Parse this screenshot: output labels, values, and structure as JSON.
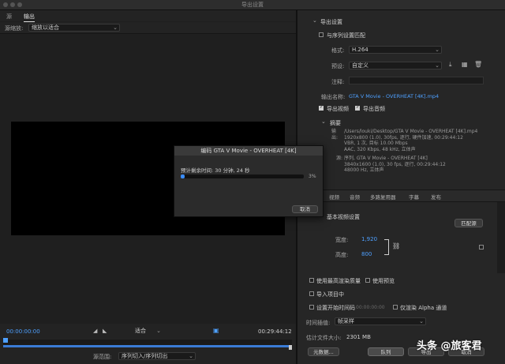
{
  "window": {
    "title": "导出设置"
  },
  "left": {
    "tabs": [
      "源",
      "输出"
    ],
    "active_tab": 1,
    "source_scaling_label": "源缩放:",
    "source_scaling_value": "缩放以适合",
    "start_timecode": "00:00:00:00",
    "end_timecode": "00:29:44:12",
    "fit_value": "适合",
    "range_label": "源范围:",
    "range_value": "序列切入/序列切出"
  },
  "export_settings": {
    "header": "导出设置",
    "match_sequence_label": "与序列设置匹配",
    "match_sequence_checked": false,
    "format_label": "格式:",
    "format_value": "H.264",
    "preset_label": "预设:",
    "preset_value": "自定义",
    "comments_label": "注释:",
    "output_name_label": "输出名称:",
    "output_name_value": "GTA V Movie - OVERHEAT [4K].mp4",
    "export_video_label": "导出视频",
    "export_video_checked": true,
    "export_audio_label": "导出音频",
    "export_audio_checked": true
  },
  "summary": {
    "header": "摘要",
    "output_label": "输出:",
    "output_lines": [
      "/Users/louki/Desktop/GTA V Movie - OVERHEAT [4K].mp4",
      "1920x800 (1.0), 30fps, 逐行, 硬件加速, 00:29:44:12",
      "VBR, 1 次, 目标 10.00 Mbps",
      "AAC, 320 Kbps, 48 kHz, 立体声"
    ],
    "source_label": "源:",
    "source_lines": [
      "序列, GTA V Movie - OVERHEAT [4K]",
      "3840x1600 (1.0), 30 fps, 逐行, 00:29:44:12",
      "48000 Hz, 立体声"
    ]
  },
  "tabs": {
    "items": [
      "视频",
      "音频",
      "多路复用器",
      "字幕",
      "发布"
    ],
    "basic_video_label": "基本视频设置",
    "match_source_button": "匹配源",
    "width_label": "宽度:",
    "width_value": "1,920",
    "height_label": "高度:",
    "height_value": "800"
  },
  "bottom_options": {
    "max_render_quality": "使用最高渲染质量",
    "use_previews": "使用预览",
    "import_into_project": "导入项目中",
    "set_start_timecode": "设置开始时间码",
    "start_timecode_value": "00:00:00:00",
    "render_alpha_only": "仅渲染 Alpha 通道",
    "time_interpolation_label": "时间插值:",
    "time_interpolation_value": "帧采样",
    "file_size_label": "估计文件大小:",
    "file_size_value": "2301 MB",
    "metadata_button": "元数据...",
    "queue_button": "队列",
    "export_button": "导出",
    "cancel_button": "取消"
  },
  "dialog": {
    "title": "编码 GTA V Movie - OVERHEAT [4K]",
    "eta_label": "预计剩余时间: 30 分钟, 24 秒",
    "progress_percent": 3,
    "progress_text": "3%",
    "cancel_button": "取消"
  },
  "watermark": {
    "text": "头条 @旅客君"
  },
  "colors": {
    "accent": "#4ea0ff",
    "progress": "#3a8dff"
  }
}
